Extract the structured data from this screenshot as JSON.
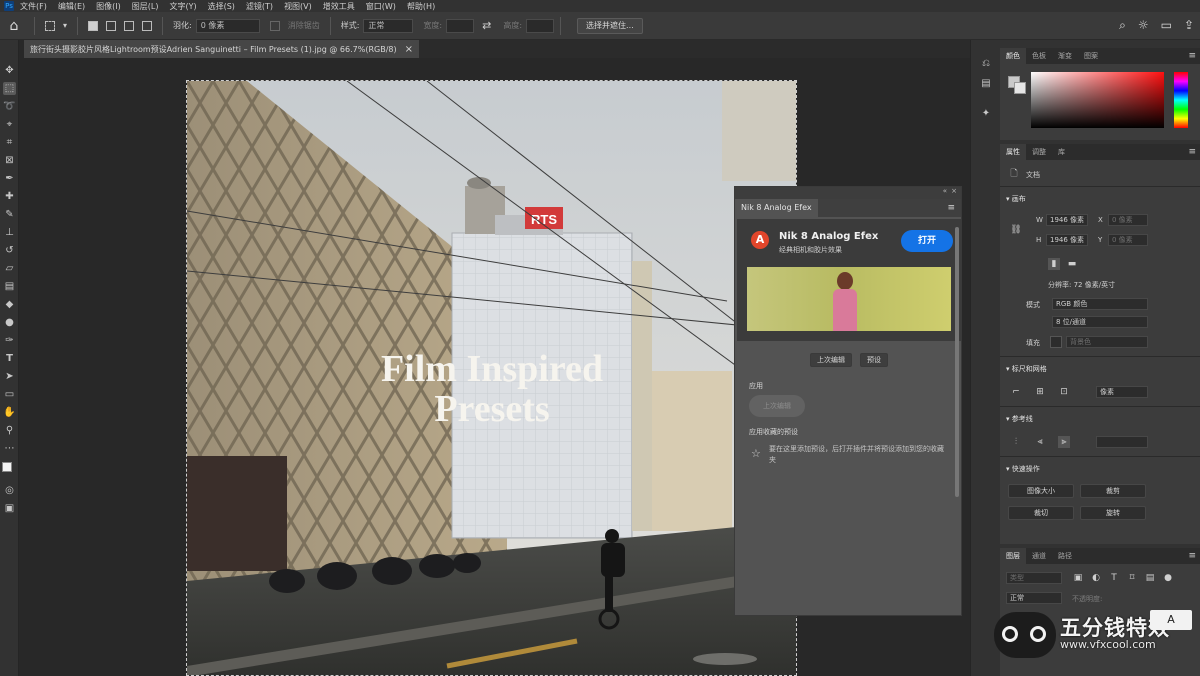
{
  "menubar": {
    "logo": "Ps",
    "items": [
      "文件(F)",
      "编辑(E)",
      "图像(I)",
      "图层(L)",
      "文字(Y)",
      "选择(S)",
      "滤镜(T)",
      "视图(V)",
      "增效工具",
      "窗口(W)",
      "帮助(H)"
    ]
  },
  "options": {
    "feather_label": "羽化:",
    "feather_value": "0 像素",
    "antialias_label": "消除锯齿",
    "style_label": "样式:",
    "style_value": "正常",
    "width_label": "宽度:",
    "height_label": "高度:",
    "select_subject_label": "选择并遮住..."
  },
  "document": {
    "tab_title": "旅行街头摄影胶片风格Lightroom预设Adrien Sanguinetti – Film Presets (1).jpg @ 66.7%(RGB/8)",
    "close": "×"
  },
  "photo": {
    "overlay_line1": "Film Inspired",
    "overlay_line2": "Presets",
    "sign": "RTS"
  },
  "nik_panel": {
    "tab": "Nik 8 Analog Efex",
    "logo": "A",
    "title": "Nik 8 Analog Efex",
    "subtitle": "经典相机和胶片效果",
    "open_button": "打开",
    "last_edit_button": "上次编辑",
    "preset_button": "预设",
    "apply_label": "应用",
    "apply_last_pill": "上次编辑",
    "favorites_label": "应用收藏的预设",
    "favorites_info": "要在这里添加预设，后打开插件并将预设添加到您的收藏夹"
  },
  "color_panel": {
    "tabs": [
      "颜色",
      "色板",
      "渐变",
      "图案"
    ]
  },
  "properties_panel": {
    "tabs": [
      "属性",
      "调整",
      "库"
    ],
    "doc_label": "文档",
    "canvas_section": "画布",
    "w_label": "W",
    "w_value": "1946 像素",
    "h_label": "H",
    "h_value": "1946 像素",
    "x_label": "X",
    "x_value": "0 像素",
    "y_label": "Y",
    "y_value": "0 像素",
    "resolution": "分辨率: 72 像素/英寸",
    "mode_label": "模式",
    "mode_value": "RGB 颜色",
    "depth_value": "8 位/通道",
    "fill_label": "填充",
    "fill_value": "背景色",
    "rulers_section": "标尺和网格",
    "rulers_unit": "像素",
    "guides_section": "参考线",
    "quick_actions_section": "快速操作",
    "quick_actions": [
      "图像大小",
      "裁剪",
      "裁切",
      "旋转"
    ]
  },
  "layers_panel": {
    "tabs": [
      "图层",
      "通道",
      "路径"
    ],
    "search_placeholder": "类型",
    "blend_mode": "正常",
    "opacity_label": "不透明度:"
  },
  "watermark": {
    "title": "五分钱特效",
    "url": "www.vfxcool.com",
    "badge": "A"
  },
  "colors": {
    "accent": "#1473e6",
    "nik_logo": "#e2462b",
    "sign_red": "#d23a3a"
  }
}
